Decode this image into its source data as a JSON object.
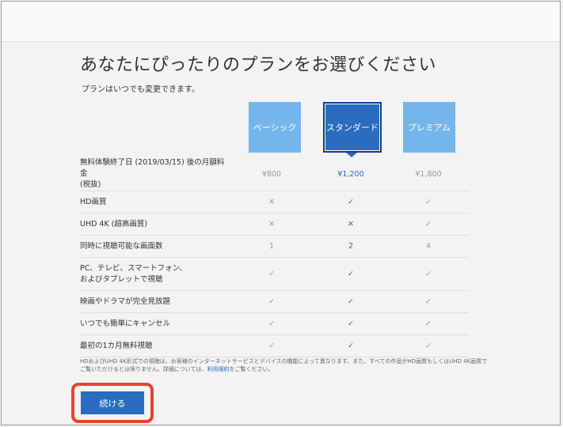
{
  "header": {
    "title": "あなたにぴったりのプランをお選びください",
    "subtitle": "プランはいつでも変更できます。"
  },
  "plans": [
    {
      "name": "ベーシック",
      "selected": false
    },
    {
      "name": "スタンダード",
      "selected": true
    },
    {
      "name": "プレミアム",
      "selected": false
    }
  ],
  "colors": {
    "plan_light": "#74b6ec",
    "plan_selected": "#2a6cbf",
    "highlight_border": "#e8432f"
  },
  "rows": [
    {
      "label": "無料体験終了日 (2019/03/15) 後の月額料金 (税抜)",
      "basic": "¥800",
      "standard": "¥1,200",
      "premium": "¥1,800",
      "height": 40
    },
    {
      "label": "HD画質",
      "basic": "✕",
      "standard": "✓",
      "premium": "✓",
      "height": 28
    },
    {
      "label": "UHD 4K (超高画質)",
      "basic": "✕",
      "standard": "✕",
      "premium": "✓",
      "height": 28
    },
    {
      "label": "同時に視聴可能な画面数",
      "basic": "1",
      "standard": "2",
      "premium": "4",
      "height": 28
    },
    {
      "label": "PC、テレビ、スマートフォン、および タブレットで視聴",
      "basic": "✓",
      "standard": "✓",
      "premium": "✓",
      "height": 42
    },
    {
      "label": "映画やドラマが完全見放題",
      "basic": "✓",
      "standard": "✓",
      "premium": "✓",
      "height": 28
    },
    {
      "label": "いつでも簡単にキャンセル",
      "basic": "✓",
      "standard": "✓",
      "premium": "✓",
      "height": 28
    },
    {
      "label": "最初の1カ月無料視聴",
      "basic": "✓",
      "standard": "✓",
      "premium": "✓",
      "height": 28
    }
  ],
  "footnote": {
    "text": "HDおよびUHD 4K形式での視聴は、お客様のインターネットサービスとデバイスの機能によって異なります。また、すべての作品がHD画質もしくはUHD 4K画質でご覧いただけるとは限りません。詳細については、",
    "link": "利用規約",
    "suffix": "をご覧ください。"
  },
  "cta": {
    "label": "続ける"
  }
}
